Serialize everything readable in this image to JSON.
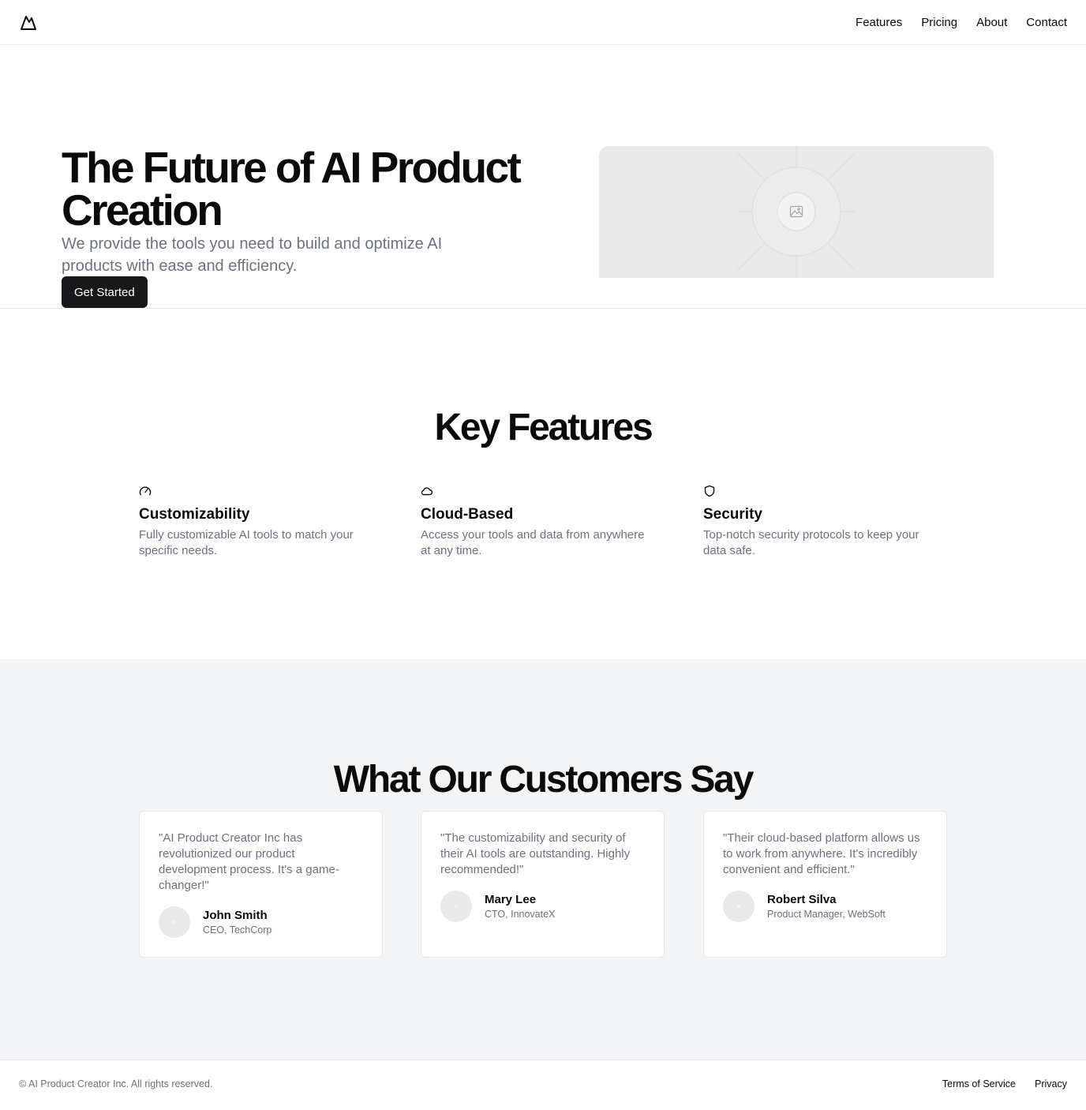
{
  "header": {
    "logo_icon": "mountain-icon",
    "nav": [
      "Features",
      "Pricing",
      "About",
      "Contact"
    ]
  },
  "hero": {
    "title": "The Future of AI Product Creation",
    "subtitle": "We provide the tools you need to build and optimize AI products with ease and efficiency.",
    "cta": "Get Started",
    "image_icon": "image-placeholder-icon"
  },
  "features": {
    "title": "Key Features",
    "items": [
      {
        "icon": "gauge-icon",
        "title": "Customizability",
        "description": "Fully customizable AI tools to match your specific needs."
      },
      {
        "icon": "cloud-icon",
        "title": "Cloud-Based",
        "description": "Access your tools and data from anywhere at any time."
      },
      {
        "icon": "shield-icon",
        "title": "Security",
        "description": "Top-notch security protocols to keep your data safe."
      }
    ]
  },
  "testimonials": {
    "title": "What Our Customers Say",
    "items": [
      {
        "quote": "\"AI Product Creator Inc has revolutionized our product development process. It's a game-changer!\"",
        "name": "John Smith",
        "role": "CEO, TechCorp"
      },
      {
        "quote": "\"The customizability and security of their AI tools are outstanding. Highly recommended!\"",
        "name": "Mary Lee",
        "role": "CTO, InnovateX"
      },
      {
        "quote": "\"Their cloud-based platform allows us to work from anywhere. It's incredibly convenient and efficient.\"",
        "name": "Robert Silva",
        "role": "Product Manager, WebSoft"
      }
    ]
  },
  "footer": {
    "copyright": "© AI Product Creator Inc. All rights reserved.",
    "links": [
      "Terms of Service",
      "Privacy"
    ]
  },
  "colors": {
    "primary_button": "#18181b",
    "muted_text": "#6b7280",
    "section_background": "#f3f4f6",
    "border": "#e5e7eb"
  }
}
